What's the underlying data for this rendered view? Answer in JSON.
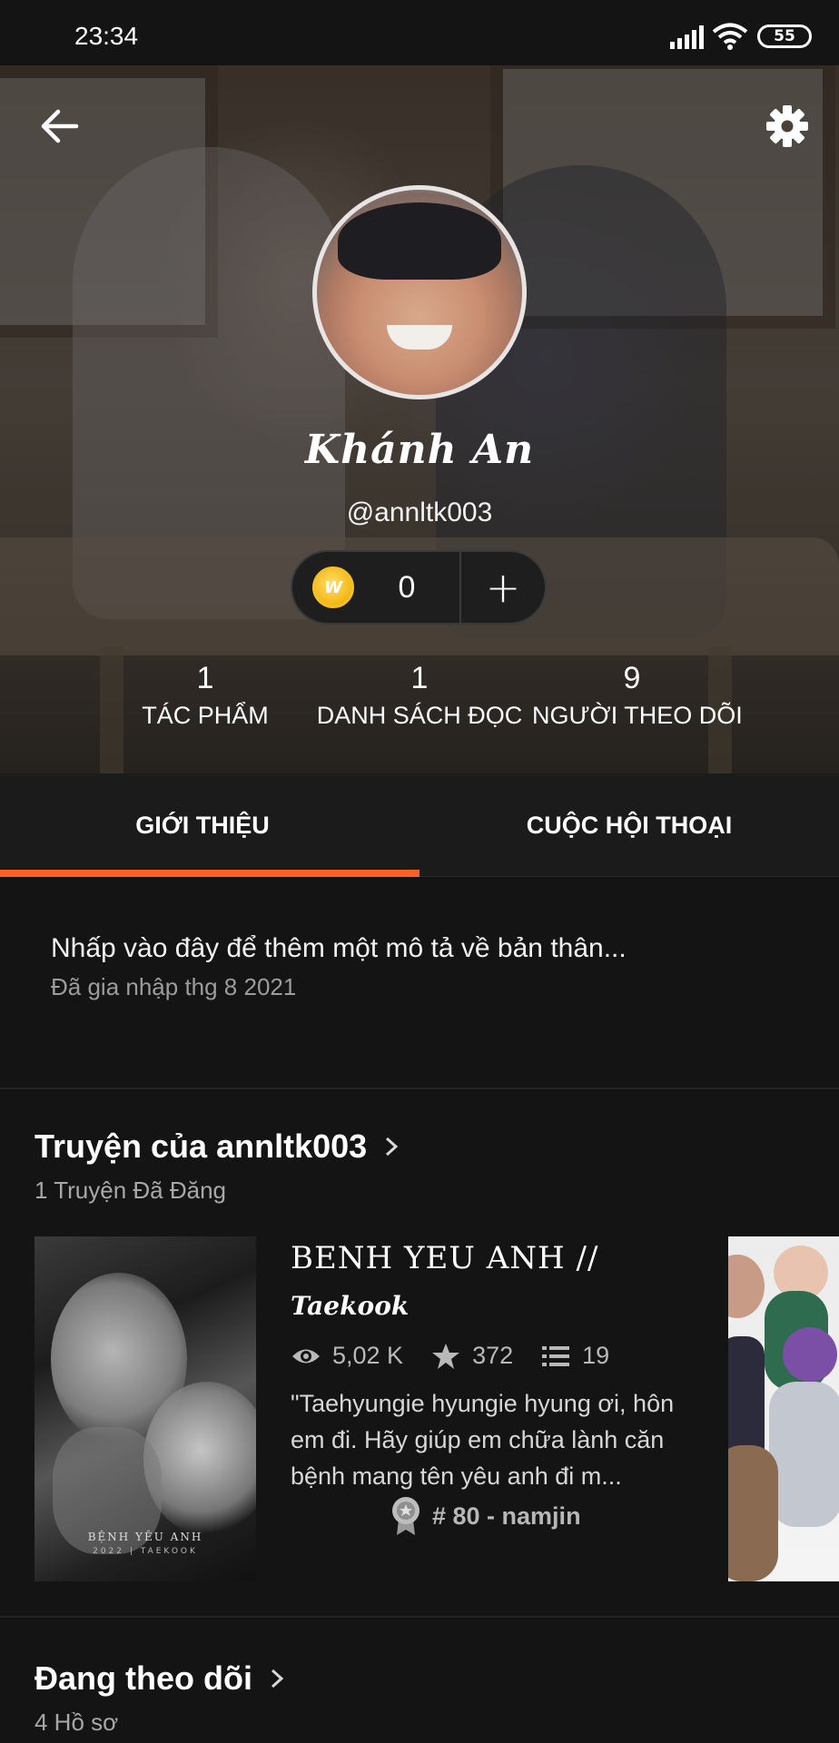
{
  "status_bar": {
    "time": "23:34",
    "battery": "55"
  },
  "profile": {
    "display_name": "Khánh An",
    "username": "@annltk003",
    "coins": "0",
    "coin_symbol": "W",
    "add_label": "+"
  },
  "stats": [
    {
      "value": "1",
      "label": "TÁC PHẨM"
    },
    {
      "value": "1",
      "label": "DANH SÁCH ĐỌC"
    },
    {
      "value": "9",
      "label": "NGƯỜI THEO DÕI"
    }
  ],
  "tabs": [
    {
      "label": "GIỚI THIỆU",
      "active": true
    },
    {
      "label": "CUỘC HỘI THOẠI",
      "active": false
    }
  ],
  "about": {
    "prompt": "Nhấp vào đây để thêm một mô tả về bản thân...",
    "joined": "Đã gia nhập thg 8 2021"
  },
  "stories_section": {
    "title": "Truyện của annltk003",
    "subtitle": "1 Truyện Đã Đăng",
    "story": {
      "cover_title": "BỆNH YÊU ANH",
      "cover_sub": "2022 | TAEKOOK",
      "title_line1": "BENH YEU ANH //",
      "title_line2": "Taekook",
      "views": "5,02 K",
      "votes": "372",
      "parts": "19",
      "blurb": "\"Taehyungie hyungie hyung ơi, hôn em đi. Hãy giúp em chữa lành căn bệnh mang tên yêu anh đi m...",
      "rank": "# 80 - namjin"
    }
  },
  "following_section": {
    "title": "Đang theo dõi",
    "subtitle": "4 Hồ sơ"
  },
  "colors": {
    "accent": "#ff6122",
    "background": "#141414",
    "tab_bar": "#1b1b1b"
  }
}
